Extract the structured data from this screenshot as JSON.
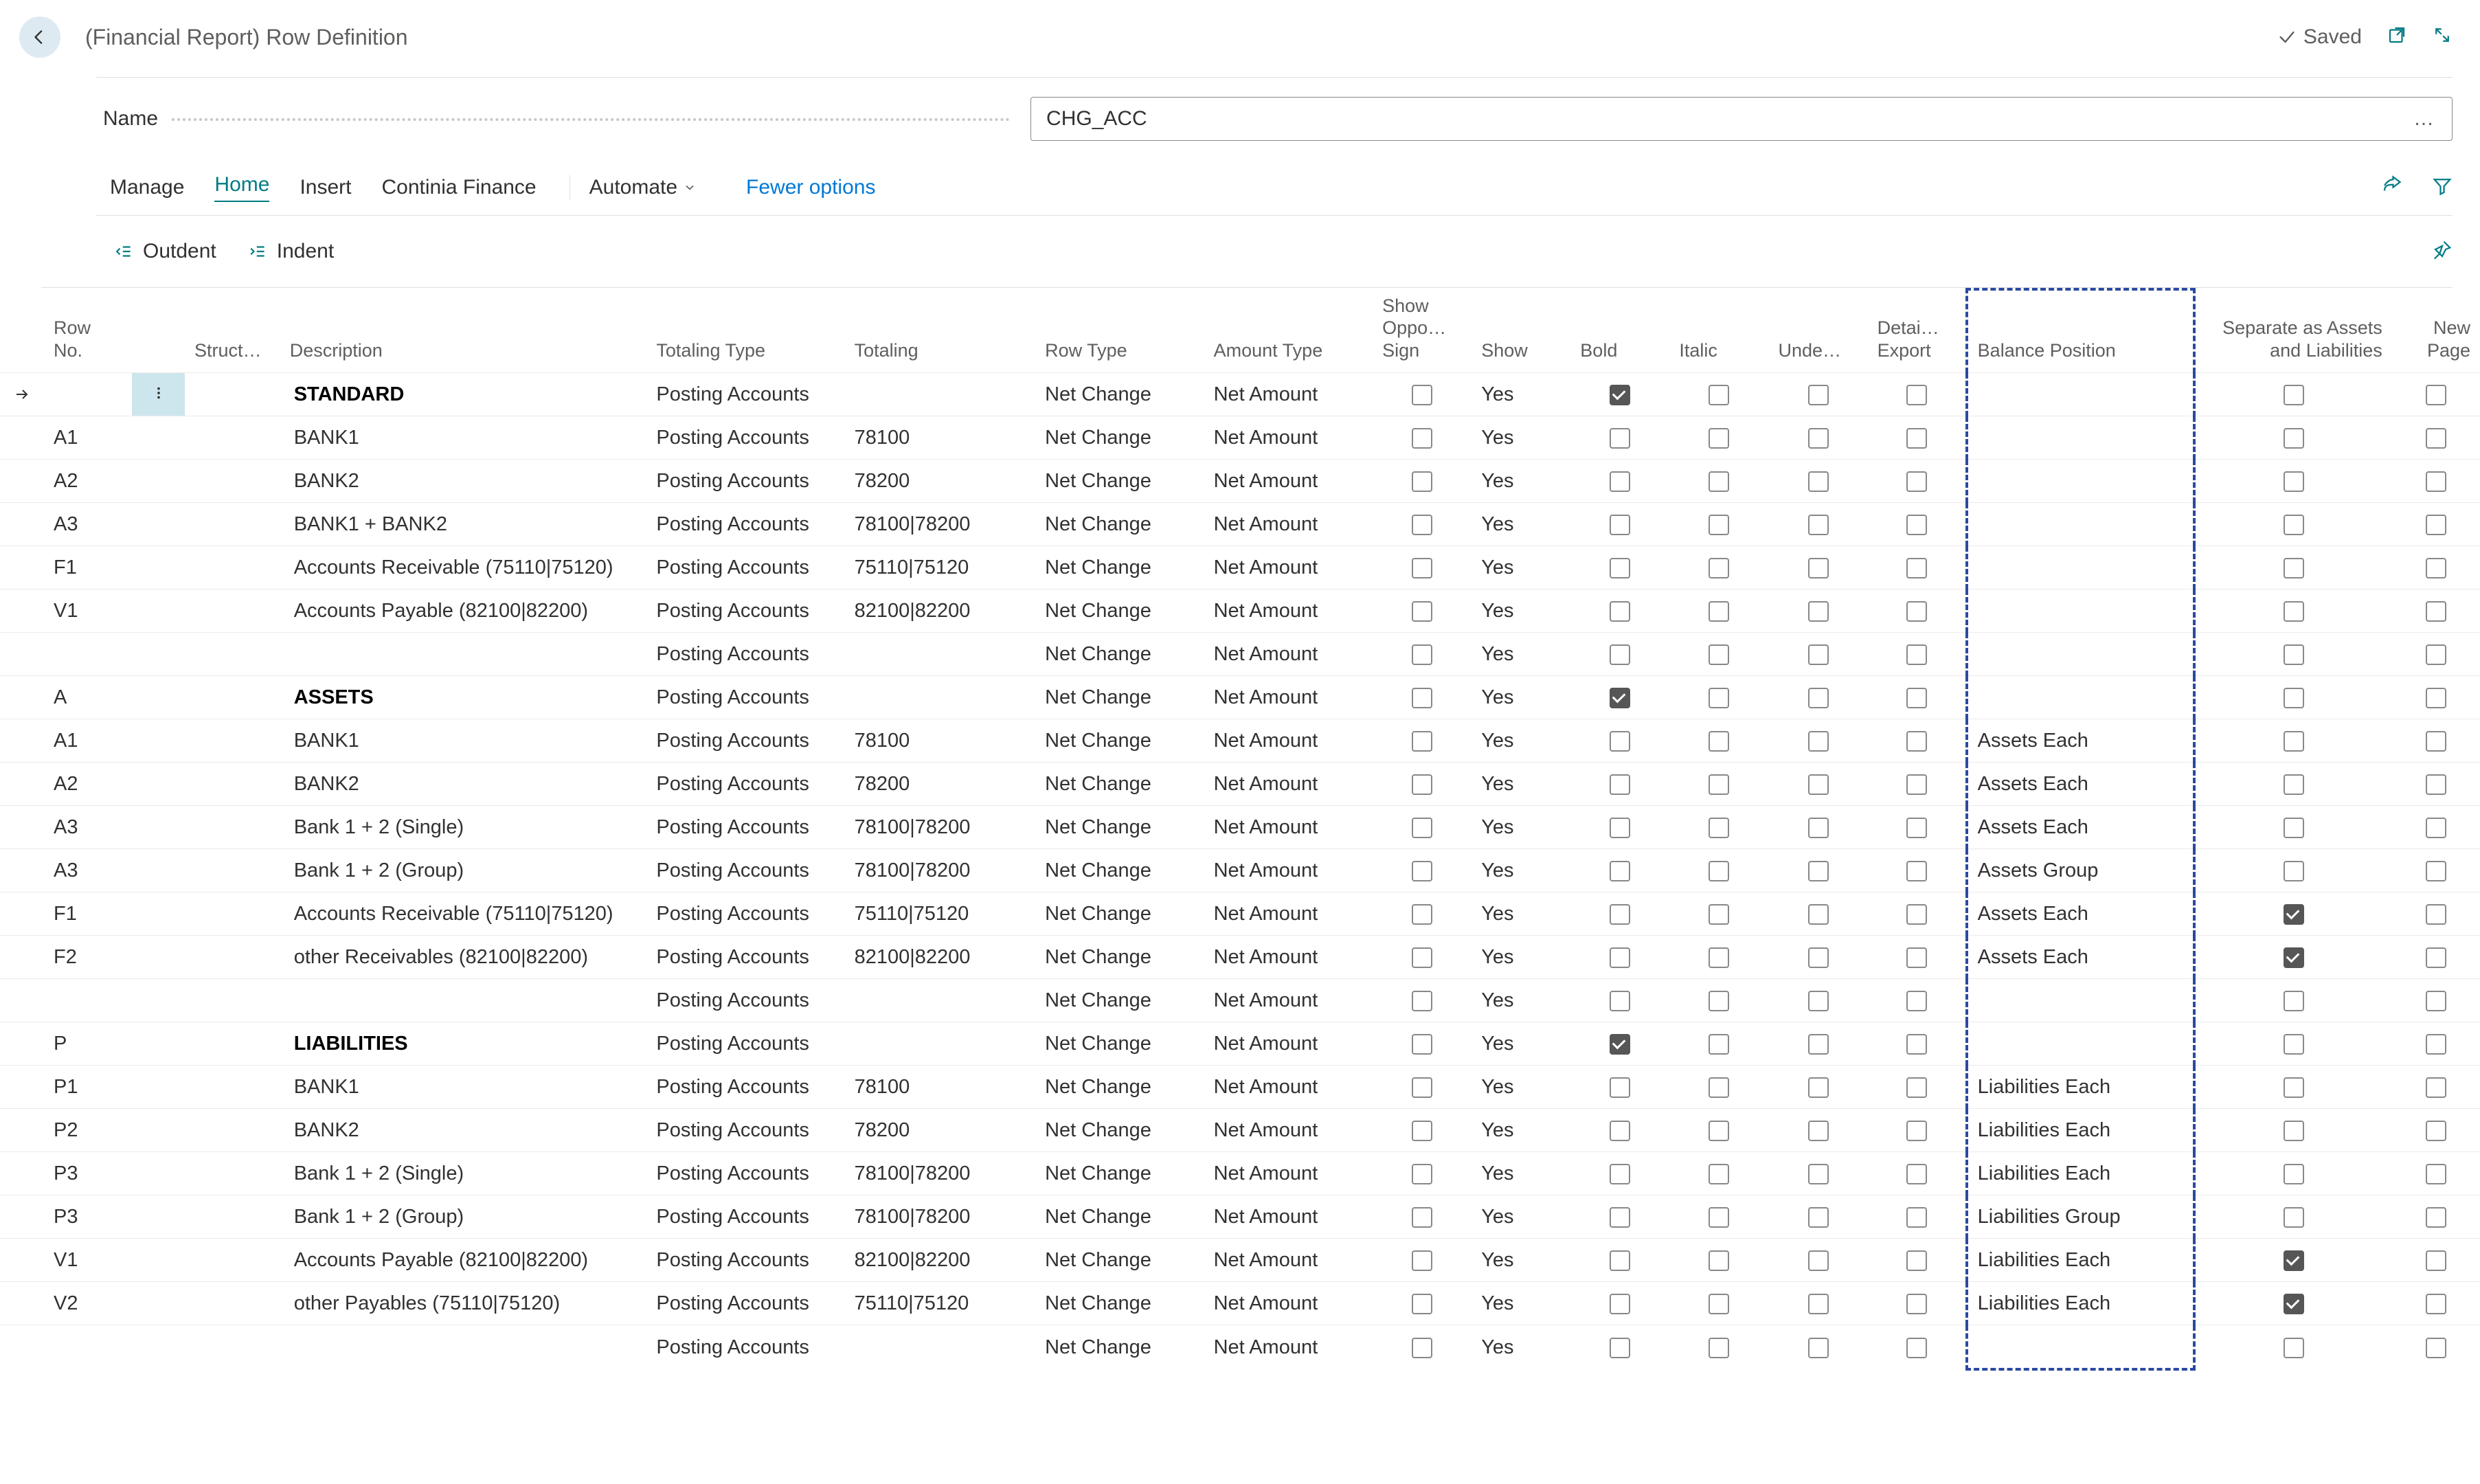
{
  "header": {
    "title": "(Financial Report) Row Definition",
    "saved_label": "Saved"
  },
  "name_field": {
    "label": "Name",
    "value": "CHG_ACC"
  },
  "tabs": {
    "manage": "Manage",
    "home": "Home",
    "insert": "Insert",
    "continia_finance": "Continia Finance",
    "automate": "Automate",
    "fewer_options": "Fewer options"
  },
  "actions": {
    "outdent": "Outdent",
    "indent": "Indent"
  },
  "columns": {
    "row_no": "Row No.",
    "struct": "Struct…",
    "description": "Description",
    "totaling_type": "Totaling Type",
    "totaling": "Totaling",
    "row_type": "Row Type",
    "amount_type": "Amount Type",
    "show_opposite": "Show Oppo… Sign",
    "show": "Show",
    "bold": "Bold",
    "italic": "Italic",
    "underline": "Unde…",
    "detail_export": "Detai… Export",
    "balance_position": "Balance Position",
    "separate": "Separate as Assets and Liabilities",
    "new_page": "New Page"
  },
  "rows": [
    {
      "row_no": "",
      "descr": "STANDARD",
      "bold_descr": true,
      "totaling_type": "Posting Accounts",
      "totaling": "",
      "row_type": "Net Change",
      "amount_type": "Net Amount",
      "show": "Yes",
      "bold": true,
      "italic": false,
      "underline": false,
      "detail": false,
      "oppo": false,
      "bp": "",
      "sep": false,
      "np": false,
      "selected": true
    },
    {
      "row_no": "A1",
      "descr": "BANK1",
      "bold_descr": false,
      "totaling_type": "Posting Accounts",
      "totaling": "78100",
      "row_type": "Net Change",
      "amount_type": "Net Amount",
      "show": "Yes",
      "bold": false,
      "italic": false,
      "underline": false,
      "detail": false,
      "oppo": false,
      "bp": "",
      "sep": false,
      "np": false
    },
    {
      "row_no": "A2",
      "descr": "BANK2",
      "bold_descr": false,
      "totaling_type": "Posting Accounts",
      "totaling": "78200",
      "row_type": "Net Change",
      "amount_type": "Net Amount",
      "show": "Yes",
      "bold": false,
      "italic": false,
      "underline": false,
      "detail": false,
      "oppo": false,
      "bp": "",
      "sep": false,
      "np": false
    },
    {
      "row_no": "A3",
      "descr": "BANK1 + BANK2",
      "bold_descr": false,
      "totaling_type": "Posting Accounts",
      "totaling": "78100|78200",
      "row_type": "Net Change",
      "amount_type": "Net Amount",
      "show": "Yes",
      "bold": false,
      "italic": false,
      "underline": false,
      "detail": false,
      "oppo": false,
      "bp": "",
      "sep": false,
      "np": false
    },
    {
      "row_no": "F1",
      "descr": "Accounts Receivable (75110|75120)",
      "bold_descr": false,
      "totaling_type": "Posting Accounts",
      "totaling": "75110|75120",
      "row_type": "Net Change",
      "amount_type": "Net Amount",
      "show": "Yes",
      "bold": false,
      "italic": false,
      "underline": false,
      "detail": false,
      "oppo": false,
      "bp": "",
      "sep": false,
      "np": false
    },
    {
      "row_no": "V1",
      "descr": "Accounts Payable (82100|82200)",
      "bold_descr": false,
      "totaling_type": "Posting Accounts",
      "totaling": "82100|82200",
      "row_type": "Net Change",
      "amount_type": "Net Amount",
      "show": "Yes",
      "bold": false,
      "italic": false,
      "underline": false,
      "detail": false,
      "oppo": false,
      "bp": "",
      "sep": false,
      "np": false
    },
    {
      "row_no": "",
      "descr": "",
      "bold_descr": false,
      "totaling_type": "Posting Accounts",
      "totaling": "",
      "row_type": "Net Change",
      "amount_type": "Net Amount",
      "show": "Yes",
      "bold": false,
      "italic": false,
      "underline": false,
      "detail": false,
      "oppo": false,
      "bp": "",
      "sep": false,
      "np": false
    },
    {
      "row_no": "A",
      "descr": "ASSETS",
      "bold_descr": true,
      "totaling_type": "Posting Accounts",
      "totaling": "",
      "row_type": "Net Change",
      "amount_type": "Net Amount",
      "show": "Yes",
      "bold": true,
      "italic": false,
      "underline": false,
      "detail": false,
      "oppo": false,
      "bp": "",
      "sep": false,
      "np": false
    },
    {
      "row_no": "A1",
      "descr": "BANK1",
      "bold_descr": false,
      "totaling_type": "Posting Accounts",
      "totaling": "78100",
      "row_type": "Net Change",
      "amount_type": "Net Amount",
      "show": "Yes",
      "bold": false,
      "italic": false,
      "underline": false,
      "detail": false,
      "oppo": false,
      "bp": "Assets Each",
      "sep": false,
      "np": false
    },
    {
      "row_no": "A2",
      "descr": "BANK2",
      "bold_descr": false,
      "totaling_type": "Posting Accounts",
      "totaling": "78200",
      "row_type": "Net Change",
      "amount_type": "Net Amount",
      "show": "Yes",
      "bold": false,
      "italic": false,
      "underline": false,
      "detail": false,
      "oppo": false,
      "bp": "Assets Each",
      "sep": false,
      "np": false
    },
    {
      "row_no": "A3",
      "descr": "Bank 1 + 2 (Single)",
      "bold_descr": false,
      "totaling_type": "Posting Accounts",
      "totaling": "78100|78200",
      "row_type": "Net Change",
      "amount_type": "Net Amount",
      "show": "Yes",
      "bold": false,
      "italic": false,
      "underline": false,
      "detail": false,
      "oppo": false,
      "bp": "Assets Each",
      "sep": false,
      "np": false
    },
    {
      "row_no": "A3",
      "descr": "Bank 1 + 2 (Group)",
      "bold_descr": false,
      "totaling_type": "Posting Accounts",
      "totaling": "78100|78200",
      "row_type": "Net Change",
      "amount_type": "Net Amount",
      "show": "Yes",
      "bold": false,
      "italic": false,
      "underline": false,
      "detail": false,
      "oppo": false,
      "bp": "Assets Group",
      "sep": false,
      "np": false
    },
    {
      "row_no": "F1",
      "descr": "Accounts Receivable (75110|75120)",
      "bold_descr": false,
      "totaling_type": "Posting Accounts",
      "totaling": "75110|75120",
      "row_type": "Net Change",
      "amount_type": "Net Amount",
      "show": "Yes",
      "bold": false,
      "italic": false,
      "underline": false,
      "detail": false,
      "oppo": false,
      "bp": "Assets Each",
      "sep": true,
      "np": false
    },
    {
      "row_no": "F2",
      "descr": "other Receivables (82100|82200)",
      "bold_descr": false,
      "totaling_type": "Posting Accounts",
      "totaling": "82100|82200",
      "row_type": "Net Change",
      "amount_type": "Net Amount",
      "show": "Yes",
      "bold": false,
      "italic": false,
      "underline": false,
      "detail": false,
      "oppo": false,
      "bp": "Assets Each",
      "sep": true,
      "np": false
    },
    {
      "row_no": "",
      "descr": "",
      "bold_descr": false,
      "totaling_type": "Posting Accounts",
      "totaling": "",
      "row_type": "Net Change",
      "amount_type": "Net Amount",
      "show": "Yes",
      "bold": false,
      "italic": false,
      "underline": false,
      "detail": false,
      "oppo": false,
      "bp": "",
      "sep": false,
      "np": false
    },
    {
      "row_no": "P",
      "descr": "LIABILITIES",
      "bold_descr": true,
      "totaling_type": "Posting Accounts",
      "totaling": "",
      "row_type": "Net Change",
      "amount_type": "Net Amount",
      "show": "Yes",
      "bold": true,
      "italic": false,
      "underline": false,
      "detail": false,
      "oppo": false,
      "bp": "",
      "sep": false,
      "np": false
    },
    {
      "row_no": "P1",
      "descr": "BANK1",
      "bold_descr": false,
      "totaling_type": "Posting Accounts",
      "totaling": "78100",
      "row_type": "Net Change",
      "amount_type": "Net Amount",
      "show": "Yes",
      "bold": false,
      "italic": false,
      "underline": false,
      "detail": false,
      "oppo": false,
      "bp": "Liabilities Each",
      "sep": false,
      "np": false
    },
    {
      "row_no": "P2",
      "descr": "BANK2",
      "bold_descr": false,
      "totaling_type": "Posting Accounts",
      "totaling": "78200",
      "row_type": "Net Change",
      "amount_type": "Net Amount",
      "show": "Yes",
      "bold": false,
      "italic": false,
      "underline": false,
      "detail": false,
      "oppo": false,
      "bp": "Liabilities Each",
      "sep": false,
      "np": false
    },
    {
      "row_no": "P3",
      "descr": "Bank 1 + 2 (Single)",
      "bold_descr": false,
      "totaling_type": "Posting Accounts",
      "totaling": "78100|78200",
      "row_type": "Net Change",
      "amount_type": "Net Amount",
      "show": "Yes",
      "bold": false,
      "italic": false,
      "underline": false,
      "detail": false,
      "oppo": false,
      "bp": "Liabilities Each",
      "sep": false,
      "np": false
    },
    {
      "row_no": "P3",
      "descr": "Bank 1 + 2 (Group)",
      "bold_descr": false,
      "totaling_type": "Posting Accounts",
      "totaling": "78100|78200",
      "row_type": "Net Change",
      "amount_type": "Net Amount",
      "show": "Yes",
      "bold": false,
      "italic": false,
      "underline": false,
      "detail": false,
      "oppo": false,
      "bp": "Liabilities Group",
      "sep": false,
      "np": false
    },
    {
      "row_no": "V1",
      "descr": "Accounts Payable (82100|82200)",
      "bold_descr": false,
      "totaling_type": "Posting Accounts",
      "totaling": "82100|82200",
      "row_type": "Net Change",
      "amount_type": "Net Amount",
      "show": "Yes",
      "bold": false,
      "italic": false,
      "underline": false,
      "detail": false,
      "oppo": false,
      "bp": "Liabilities Each",
      "sep": true,
      "np": false
    },
    {
      "row_no": "V2",
      "descr": "other Payables (75110|75120)",
      "bold_descr": false,
      "totaling_type": "Posting Accounts",
      "totaling": "75110|75120",
      "row_type": "Net Change",
      "amount_type": "Net Amount",
      "show": "Yes",
      "bold": false,
      "italic": false,
      "underline": false,
      "detail": false,
      "oppo": false,
      "bp": "Liabilities Each",
      "sep": true,
      "np": false
    },
    {
      "row_no": "",
      "descr": "",
      "bold_descr": false,
      "totaling_type": "Posting Accounts",
      "totaling": "",
      "row_type": "Net Change",
      "amount_type": "Net Amount",
      "show": "Yes",
      "bold": false,
      "italic": false,
      "underline": false,
      "detail": false,
      "oppo": false,
      "bp": "",
      "sep": false,
      "np": false,
      "last": true
    }
  ]
}
